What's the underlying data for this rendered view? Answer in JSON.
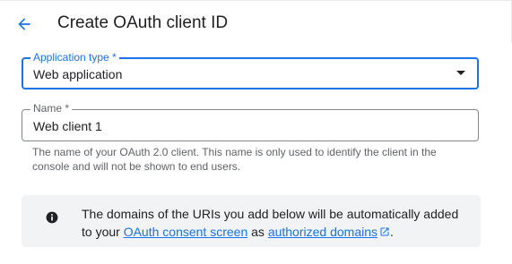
{
  "header": {
    "back_icon": "arrow-back-icon",
    "title": "Create OAuth client ID"
  },
  "application_type": {
    "label": "Application type *",
    "value": "Web application",
    "icon": "dropdown-arrow-icon"
  },
  "name_field": {
    "label": "Name *",
    "value": "Web client 1",
    "helper_line1": "The name of your OAuth 2.0 client. This name is only used to identify the client in the",
    "helper_line2": "console and will not be shown to end users."
  },
  "info": {
    "icon": "info-icon",
    "line1": "The domains of the URIs you add below will be automatically added",
    "line2_prefix": "to your ",
    "consent_link": "OAuth consent screen",
    "middle": " as ",
    "domains_link": "authorized domains",
    "external_icon": "open-in-new-icon",
    "suffix": "."
  },
  "colors": {
    "accent": "#1a73e8",
    "text": "#202124",
    "secondary_text": "#5f6368",
    "info_background": "#f1f3f4"
  }
}
